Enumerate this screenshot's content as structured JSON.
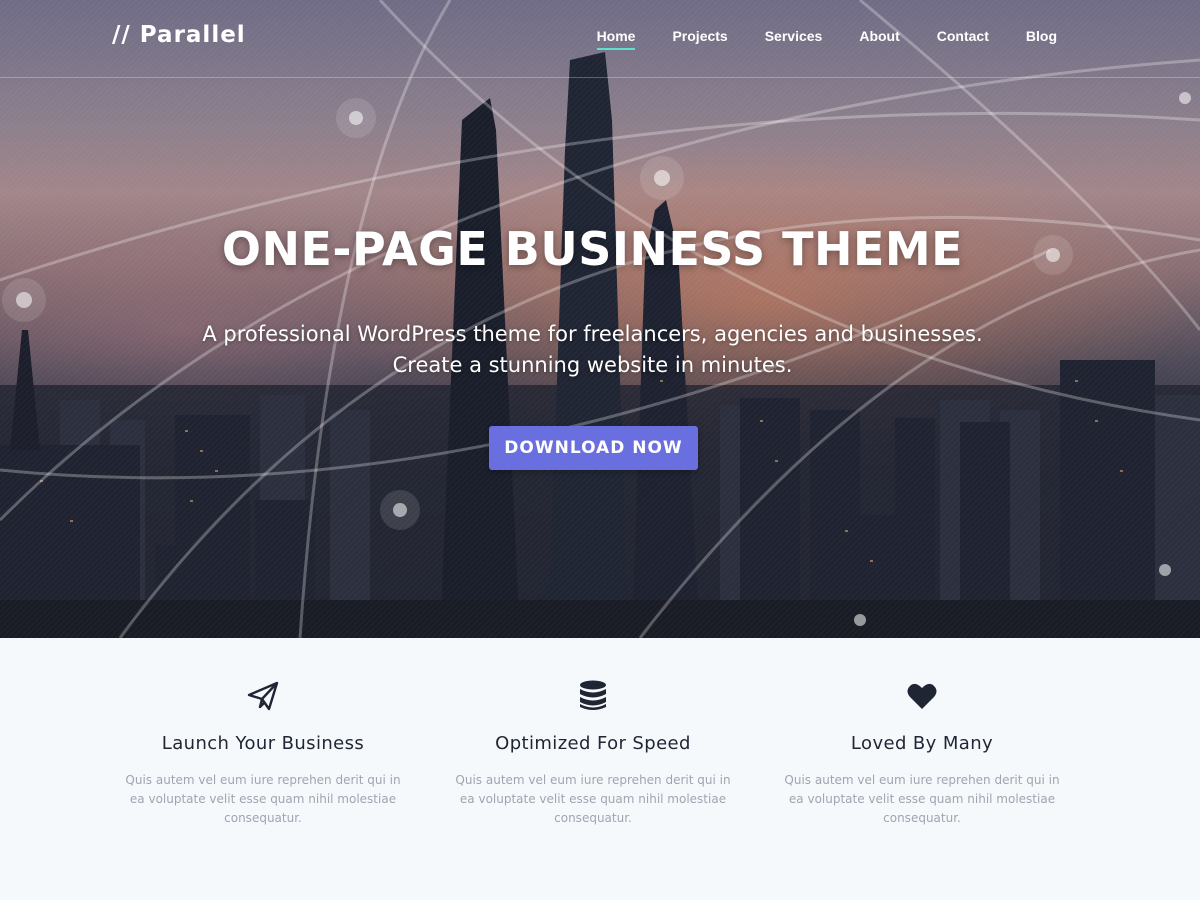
{
  "brand": "// Parallel",
  "nav": {
    "items": [
      {
        "label": "Home",
        "active": true
      },
      {
        "label": "Projects"
      },
      {
        "label": "Services"
      },
      {
        "label": "About"
      },
      {
        "label": "Contact"
      },
      {
        "label": "Blog"
      }
    ]
  },
  "hero": {
    "title": "ONE-PAGE BUSINESS THEME",
    "subtitle_line1": "A professional WordPress theme for freelancers, agencies and businesses.",
    "subtitle_line2": "Create a stunning website in minutes.",
    "cta_label": "DOWNLOAD NOW"
  },
  "features": [
    {
      "icon": "paper-plane-icon",
      "title": "Launch Your Business",
      "text": "Quis autem vel eum iure reprehen derit qui in ea voluptate velit esse quam nihil molestiae consequatur."
    },
    {
      "icon": "database-icon",
      "title": "Optimized For Speed",
      "text": "Quis autem vel eum iure reprehen derit qui in ea voluptate velit esse quam nihil molestiae consequatur."
    },
    {
      "icon": "heart-icon",
      "title": "Loved By Many",
      "text": "Quis autem vel eum iure reprehen derit qui in ea voluptate velit esse quam nihil molestiae consequatur."
    }
  ],
  "colors": {
    "accent_underline": "#5ee0cf",
    "cta_background": "#6a6fe0",
    "features_background": "#f6f9fc",
    "feature_title": "#1f2533",
    "feature_text": "#9ea5b1"
  }
}
